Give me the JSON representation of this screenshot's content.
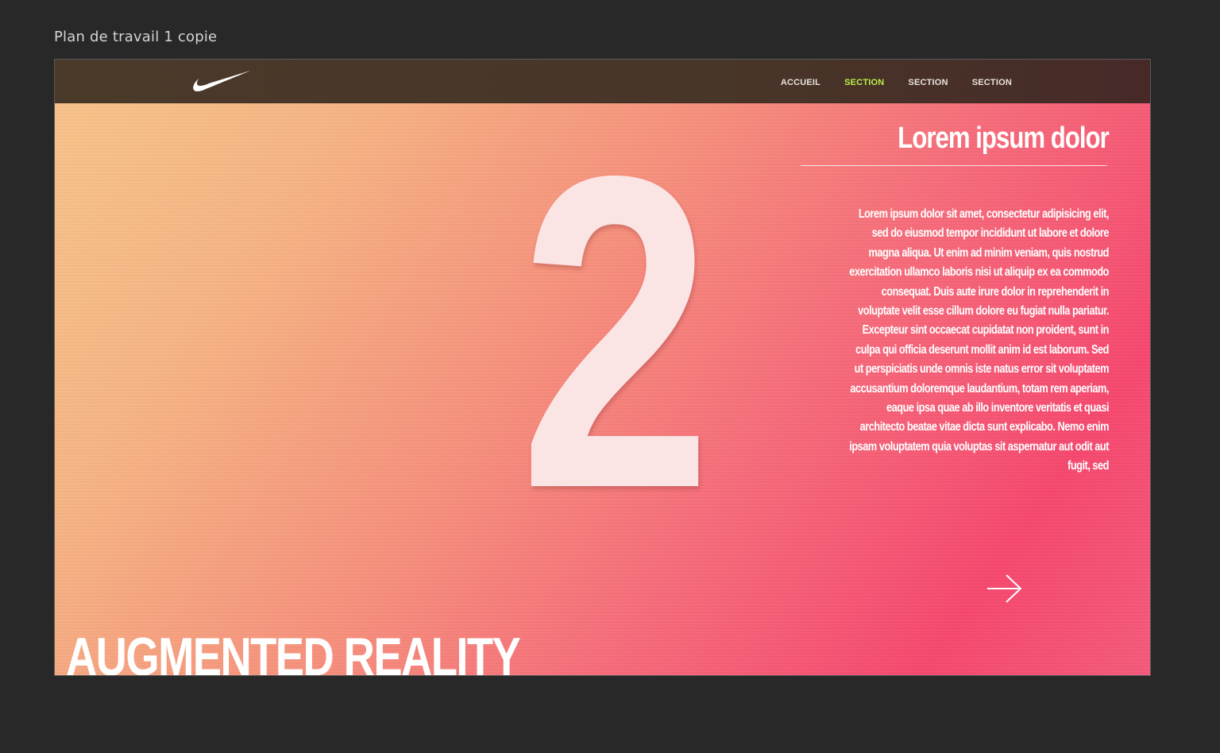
{
  "artboard": {
    "label": "Plan de travail 1 copie"
  },
  "header": {
    "logo_icon": "swoosh-icon",
    "nav": [
      {
        "label": "ACCUEIL",
        "active": false
      },
      {
        "label": "SECTION",
        "active": true
      },
      {
        "label": "SECTION",
        "active": false
      },
      {
        "label": "SECTION",
        "active": false
      }
    ],
    "active_color": "#b8f04a"
  },
  "hero": {
    "number": "2",
    "title": "Lorem ipsum dolor",
    "body": "Lorem ipsum dolor sit amet, consectetur adipisicing elit, sed do eiusmod tempor incididunt ut labore et dolore magna aliqua. Ut enim ad minim veniam, quis nostrud exercitation ullamco laboris nisi ut aliquip ex ea commodo consequat. Duis aute irure dolor in reprehenderit in voluptate velit esse cillum dolore eu fugiat nulla pariatur. Excepteur sint occaecat cupidatat non proident, sunt in culpa qui officia deserunt mollit anim id est laborum. Sed ut perspiciatis unde omnis iste natus error sit voluptatem accusantium doloremque laudantium, totam rem aperiam, eaque ipsa quae ab illo inventore veritatis et quasi architecto beatae vitae dicta sunt explicabo. Nemo enim ipsam voluptatem quia voluptas sit aspernatur aut odit aut fugit, sed",
    "next_icon": "arrow-right-icon",
    "footer_title": "AUGMENTED REALITY"
  },
  "colors": {
    "background": "#282828",
    "gradient_start": "#f7c48a",
    "gradient_end": "#f6486f",
    "navbar": "#483628"
  }
}
